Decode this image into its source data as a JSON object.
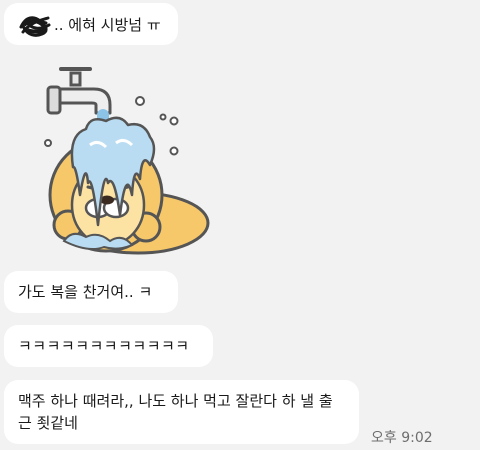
{
  "messages": [
    {
      "text": ".. 에혀 시방넘 ㅠ"
    },
    {
      "text": "가도 복을 찬거여.. ㅋ"
    },
    {
      "text": "ㅋㅋㅋㅋㅋㅋㅋㅋㅋㅋㅋㅋ"
    },
    {
      "text": "맥주 하나 때려라,, 나도 하나 먹고 잘란다 하 낼 출근 죗같네"
    }
  ],
  "timestamp": "오후 9:02",
  "sticker": {
    "icon": "lion-under-faucet-sticker"
  },
  "colors": {
    "background": "#f2f2f2",
    "bubble": "#ffffff",
    "lion_mane": "#f6c86a",
    "water": "#b9dcf2"
  }
}
